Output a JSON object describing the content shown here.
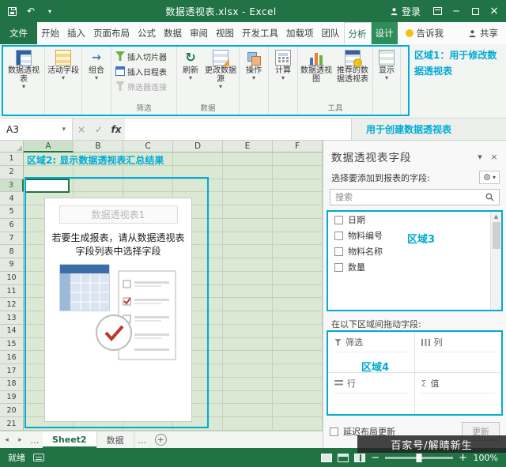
{
  "colors": {
    "excel_green": "#217346",
    "annotation_teal": "#00abd4",
    "grid_green": "#dbe8d4"
  },
  "title_bar": {
    "title": "数据透视表.xlsx - Excel",
    "sign_in": "登录"
  },
  "ribbon_tabs": {
    "file": "文件",
    "tabs": [
      {
        "label": "开始"
      },
      {
        "label": "插入"
      },
      {
        "label": "页面布局"
      },
      {
        "label": "公式"
      },
      {
        "label": "数据"
      },
      {
        "label": "审阅"
      },
      {
        "label": "视图"
      },
      {
        "label": "开发工具"
      },
      {
        "label": "加载项"
      },
      {
        "label": "团队"
      },
      {
        "label": "分析",
        "active": true,
        "contextual": true
      },
      {
        "label": "设计",
        "contextual": true
      }
    ],
    "tell_me": "告诉我",
    "share": "共享"
  },
  "ribbon": {
    "buttons": {
      "pivottable": "数据透视表",
      "active_field": "活动字段",
      "group": "组合",
      "insert_slicer": "插入切片器",
      "insert_timeline": "插入日程表",
      "filter_connections": "筛选器连接",
      "refresh": "刷新",
      "change_source": "更改数据源",
      "actions": "操作",
      "calculations": "计算",
      "pivotchart": "数据透视图",
      "recommended": "推荐的数据透视表",
      "show": "显示"
    },
    "group_labels": {
      "filter": "筛选",
      "data": "数据",
      "tools": "工具"
    },
    "annotation_area1": "区域1：用于修改数据透视表"
  },
  "formula_bar": {
    "name_box": "A3",
    "fx_label": "fx",
    "annotation_create": "用于创建数据透视表"
  },
  "sheet": {
    "columns": [
      "A",
      "B",
      "C",
      "D",
      "E",
      "F"
    ],
    "row_count": 21,
    "active_cell": "A3",
    "annotation_area2": "区域2: 显示数据透视表汇总结果",
    "placeholder": {
      "title": "数据透视表1",
      "body": "若要生成报表，请从数据透视表字段列表中选择字段"
    }
  },
  "pane": {
    "title": "数据透视表字段",
    "choose_label": "选择要添加到报表的字段:",
    "search_placeholder": "搜索",
    "fields": [
      "日期",
      "物料编号",
      "物料名称",
      "数量"
    ],
    "annotation_area3": "区域3",
    "drag_label": "在以下区域间拖动字段:",
    "areas": [
      {
        "icon": "filter",
        "label": "筛选"
      },
      {
        "icon": "columns",
        "label": "列"
      },
      {
        "icon": "rows",
        "label": "行"
      },
      {
        "icon": "values",
        "label": "值"
      }
    ],
    "annotation_area4": "区域4",
    "defer_label": "延迟布局更新",
    "update_button": "更新"
  },
  "sheet_tabs": {
    "overflow": "…",
    "tabs": [
      {
        "label": "Sheet2",
        "active": true
      },
      {
        "label": "数据",
        "active": false
      }
    ]
  },
  "status_bar": {
    "ready": "就绪",
    "zoom": "100%"
  },
  "watermark": "百家号/解晴新生"
}
